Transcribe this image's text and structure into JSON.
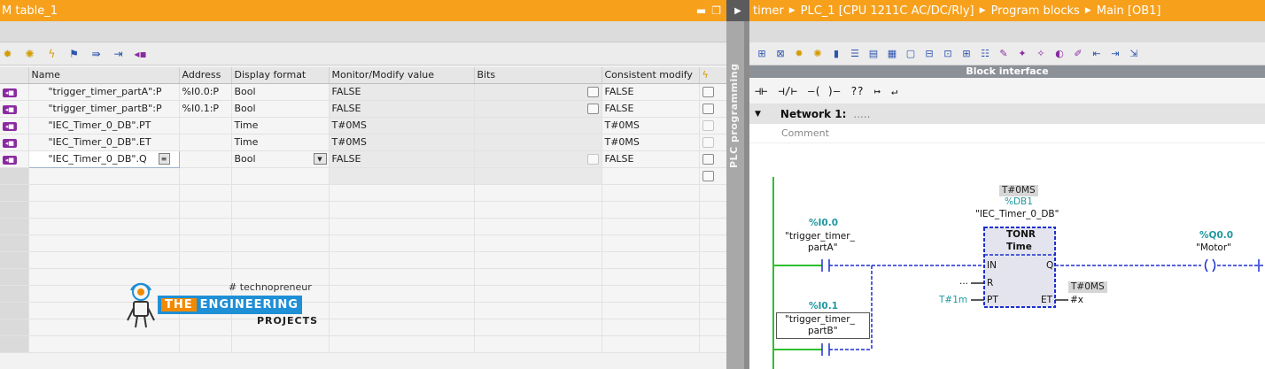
{
  "watch": {
    "title": "M table_1",
    "columns": [
      "Name",
      "Address",
      "Display format",
      "Monitor/Modify value",
      "Bits",
      "Consistent modify"
    ],
    "rows": [
      {
        "name": "\"trigger_timer_partA\":P",
        "address": "%I0.0:P",
        "format": "Bool",
        "value": "FALSE",
        "consistent": "FALSE"
      },
      {
        "name": "\"trigger_timer_partB\":P",
        "address": "%I0.1:P",
        "format": "Bool",
        "value": "FALSE",
        "consistent": "FALSE"
      },
      {
        "name": "\"IEC_Timer_0_DB\".PT",
        "address": "",
        "format": "Time",
        "value": "T#0MS",
        "consistent": "T#0MS"
      },
      {
        "name": "\"IEC_Timer_0_DB\".ET",
        "address": "",
        "format": "Time",
        "value": "T#0MS",
        "consistent": "T#0MS"
      },
      {
        "name": "\"IEC_Timer_0_DB\".Q",
        "address": "",
        "format": "Bool",
        "value": "FALSE",
        "consistent": "FALSE"
      }
    ]
  },
  "logo": {
    "tagline": "# technopreneur",
    "the": "THE",
    "engineering": "ENGINEERING",
    "projects": "PROJECTS"
  },
  "divider": {
    "label": "PLC programming"
  },
  "editor": {
    "breadcrumb": [
      "timer",
      "PLC_1 [CPU 1211C AC/DC/Rly]",
      "Program blocks",
      "Main [OB1]"
    ],
    "block_interface": "Block interface",
    "network_title": "Network 1:",
    "network_dots": ".....",
    "comment_placeholder": "Comment",
    "ladder": {
      "timer_pt_value": "T#0MS",
      "timer_db_addr": "%DB1",
      "timer_db_name": "\"IEC_Timer_0_DB\"",
      "timer_type": "TONR",
      "timer_subtype": "Time",
      "pin_in": "IN",
      "pin_q": "Q",
      "pin_r": "R",
      "pin_pt": "PT",
      "pin_et": "ET",
      "r_value": "...",
      "pt_value": "T#1m",
      "et_monitor": "T#0MS",
      "et_var": "#x",
      "contact1_addr": "%I0.0",
      "contact1_name_1": "\"trigger_timer_",
      "contact1_name_2": "partA\"",
      "contact2_addr": "%I0.1",
      "contact2_name_1": "\"trigger_timer_",
      "contact2_name_2": "partB\"",
      "coil_addr": "%Q0.0",
      "coil_name": "\"Motor\""
    },
    "lad_palette": [
      "⊣⊢",
      "⊣/⊢",
      "–( )–",
      "??",
      "↦",
      "↵"
    ]
  },
  "colors": {
    "accent_orange": "#f7a01c",
    "ladder_green": "#2fbf2f",
    "ladder_blue": "#1d2fd0",
    "teal": "#2098a0"
  }
}
